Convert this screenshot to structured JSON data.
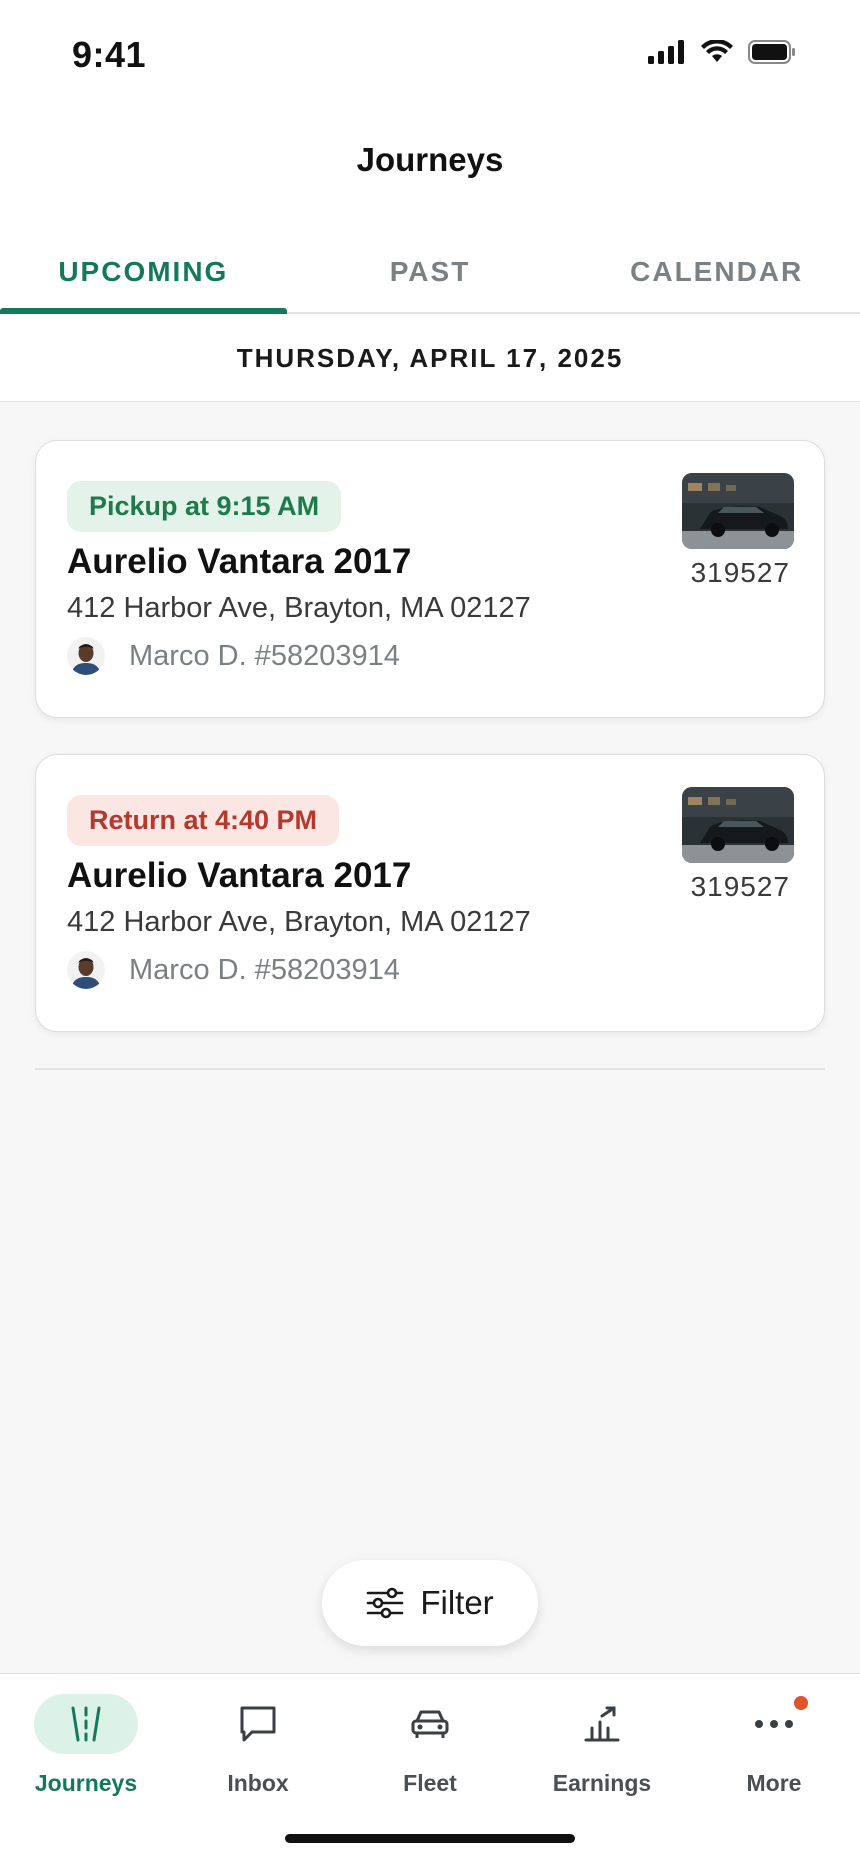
{
  "status_bar": {
    "time": "9:41"
  },
  "header": {
    "title": "Journeys"
  },
  "tabs": [
    {
      "label": "UPCOMING",
      "active": true
    },
    {
      "label": "PAST",
      "active": false
    },
    {
      "label": "CALENDAR",
      "active": false
    }
  ],
  "date_header": "THURSDAY, APRIL 17, 2025",
  "journeys": [
    {
      "badge": "Pickup at 9:15 AM",
      "badge_type": "pickup",
      "car": "Aurelio Vantara 2017",
      "address": "412 Harbor Ave, Brayton, MA 02127",
      "driver": "Marco D. #58203914",
      "vehicle_id": "319527"
    },
    {
      "badge": "Return at 4:40 PM",
      "badge_type": "return",
      "car": "Aurelio Vantara 2017",
      "address": "412 Harbor Ave, Brayton, MA 02127",
      "driver": "Marco D. #58203914",
      "vehicle_id": "319527"
    }
  ],
  "filter": {
    "label": "Filter",
    "icon": "sliders-icon"
  },
  "bottom_nav": [
    {
      "label": "Journeys",
      "icon": "journeys-road-icon",
      "active": true
    },
    {
      "label": "Inbox",
      "icon": "chat-bubble-icon",
      "active": false
    },
    {
      "label": "Fleet",
      "icon": "car-icon",
      "active": false
    },
    {
      "label": "Earnings",
      "icon": "earnings-chart-icon",
      "active": false
    },
    {
      "label": "More",
      "icon": "more-dots-icon",
      "active": false,
      "notification": true
    }
  ],
  "colors": {
    "accent": "#13795b",
    "pickup_bg": "#e3f3ea",
    "pickup_text": "#1d7a4c",
    "return_bg": "#fbe6e3",
    "return_text": "#b3382d",
    "notification": "#e0532b"
  }
}
